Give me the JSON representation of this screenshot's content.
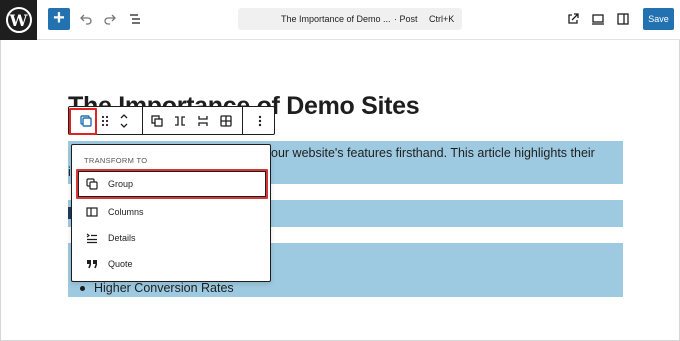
{
  "topbar": {
    "logo": "W",
    "add_label": "+",
    "icons": [
      "undo-icon",
      "redo-icon",
      "list-view-icon",
      "view-external-icon",
      "device-preview-icon",
      "sidebar-toggle-icon"
    ],
    "document_title": "The Importance of Demo ...",
    "document_type": "· Post",
    "shortcut": "Ctrl+K",
    "save_label": "Save",
    "accent_color": "#2271b1"
  },
  "editor": {
    "post_title": "The Importance of Demo Sites",
    "paragraph_visible": "our website's features firsthand. This article highlights their",
    "paragraph_second_line": "i",
    "list_item": "Higher Conversion Rates",
    "selection_color": "#9ecae1"
  },
  "block_toolbar": {
    "icons": [
      "group-icon",
      "drag-handle-icon",
      "move-arrows-icon",
      "duplicate-icon",
      "columns-alt-icon",
      "stack-icon",
      "grid-icon",
      "more-options-icon"
    ]
  },
  "transform_menu": {
    "heading": "TRANSFORM TO",
    "items": [
      {
        "label": "Group",
        "icon": "group-icon"
      },
      {
        "label": "Columns",
        "icon": "columns-icon"
      },
      {
        "label": "Details",
        "icon": "details-icon"
      },
      {
        "label": "Quote",
        "icon": "quote-icon"
      }
    ],
    "highlight_color": "#d63638"
  }
}
